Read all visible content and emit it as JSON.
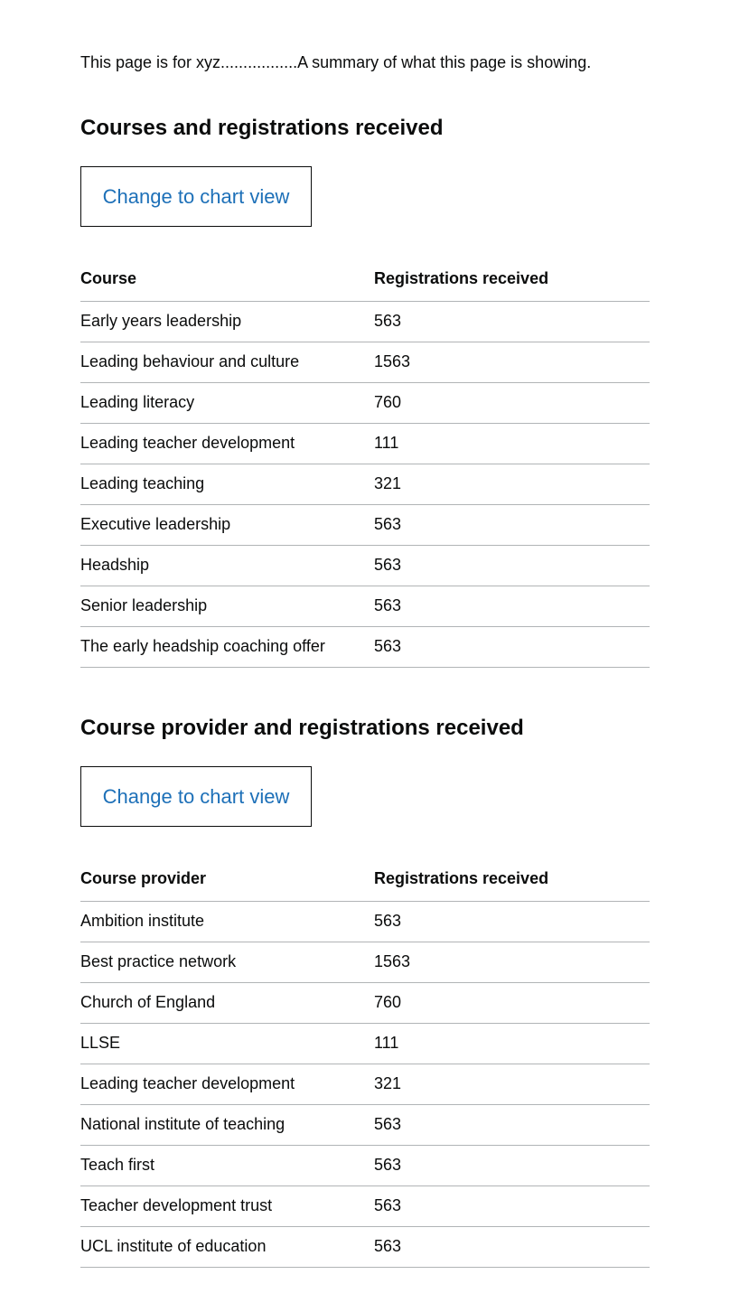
{
  "summary": "This page is for xyz.................A summary of what this page is showing.",
  "section1": {
    "heading": "Courses and registrations received",
    "button_label": "Change to chart view",
    "columns": [
      "Course",
      "Registrations received"
    ],
    "rows": [
      [
        "Early years leadership",
        "563"
      ],
      [
        "Leading behaviour and culture",
        "1563"
      ],
      [
        "Leading literacy",
        "760"
      ],
      [
        "Leading teacher development",
        "111"
      ],
      [
        "Leading teaching",
        "321"
      ],
      [
        "Executive leadership",
        "563"
      ],
      [
        "Headship",
        "563"
      ],
      [
        "Senior leadership",
        "563"
      ],
      [
        "The early headship coaching offer",
        "563"
      ]
    ]
  },
  "section2": {
    "heading": "Course provider and registrations received",
    "button_label": "Change to chart view",
    "columns": [
      "Course provider",
      "Registrations received"
    ],
    "rows": [
      [
        "Ambition institute",
        "563"
      ],
      [
        "Best practice network",
        "1563"
      ],
      [
        "Church of England",
        "760"
      ],
      [
        "LLSE",
        "111"
      ],
      [
        "Leading teacher development",
        "321"
      ],
      [
        "National institute of teaching",
        "563"
      ],
      [
        "Teach first",
        "563"
      ],
      [
        "Teacher development trust",
        "563"
      ],
      [
        "UCL institute of education",
        "563"
      ]
    ]
  }
}
